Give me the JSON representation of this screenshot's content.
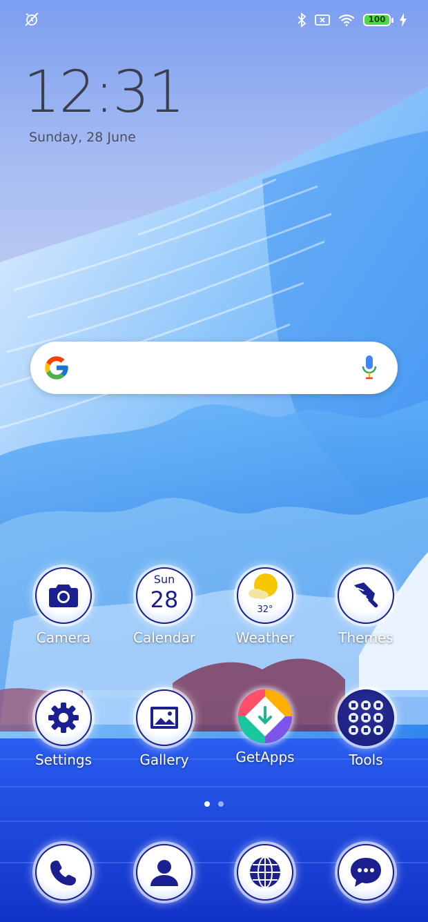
{
  "status_bar": {
    "left_icon": "alarm-off-icon",
    "right_icons": [
      "bluetooth-icon",
      "no-sim-icon",
      "wifi-icon",
      "battery-icon",
      "charging-icon"
    ],
    "battery_level": "100"
  },
  "clock": {
    "time": "12:31",
    "date": "Sunday, 28 June"
  },
  "search": {
    "logo": "google-logo",
    "mic_icon": "mic-icon"
  },
  "apps": [
    {
      "label": "Camera",
      "icon": "camera-icon"
    },
    {
      "label": "Calendar",
      "icon": "calendar-icon",
      "day": "Sun",
      "date": "28"
    },
    {
      "label": "Weather",
      "icon": "weather-icon",
      "temp": "32°"
    },
    {
      "label": "Themes",
      "icon": "paintbrush-icon"
    },
    {
      "label": "Settings",
      "icon": "gear-icon"
    },
    {
      "label": "Gallery",
      "icon": "image-icon"
    },
    {
      "label": "GetApps",
      "icon": "getapps-icon"
    },
    {
      "label": "Tools",
      "icon": "folder-icon"
    }
  ],
  "page_indicator": {
    "pages": 2,
    "current": 1
  },
  "dock": [
    {
      "icon": "phone-icon"
    },
    {
      "icon": "contacts-icon"
    },
    {
      "icon": "browser-icon"
    },
    {
      "icon": "messages-icon"
    }
  ],
  "colors": {
    "icon_accent": "#1b1f8f",
    "accent_blue": "#2f57e6"
  }
}
